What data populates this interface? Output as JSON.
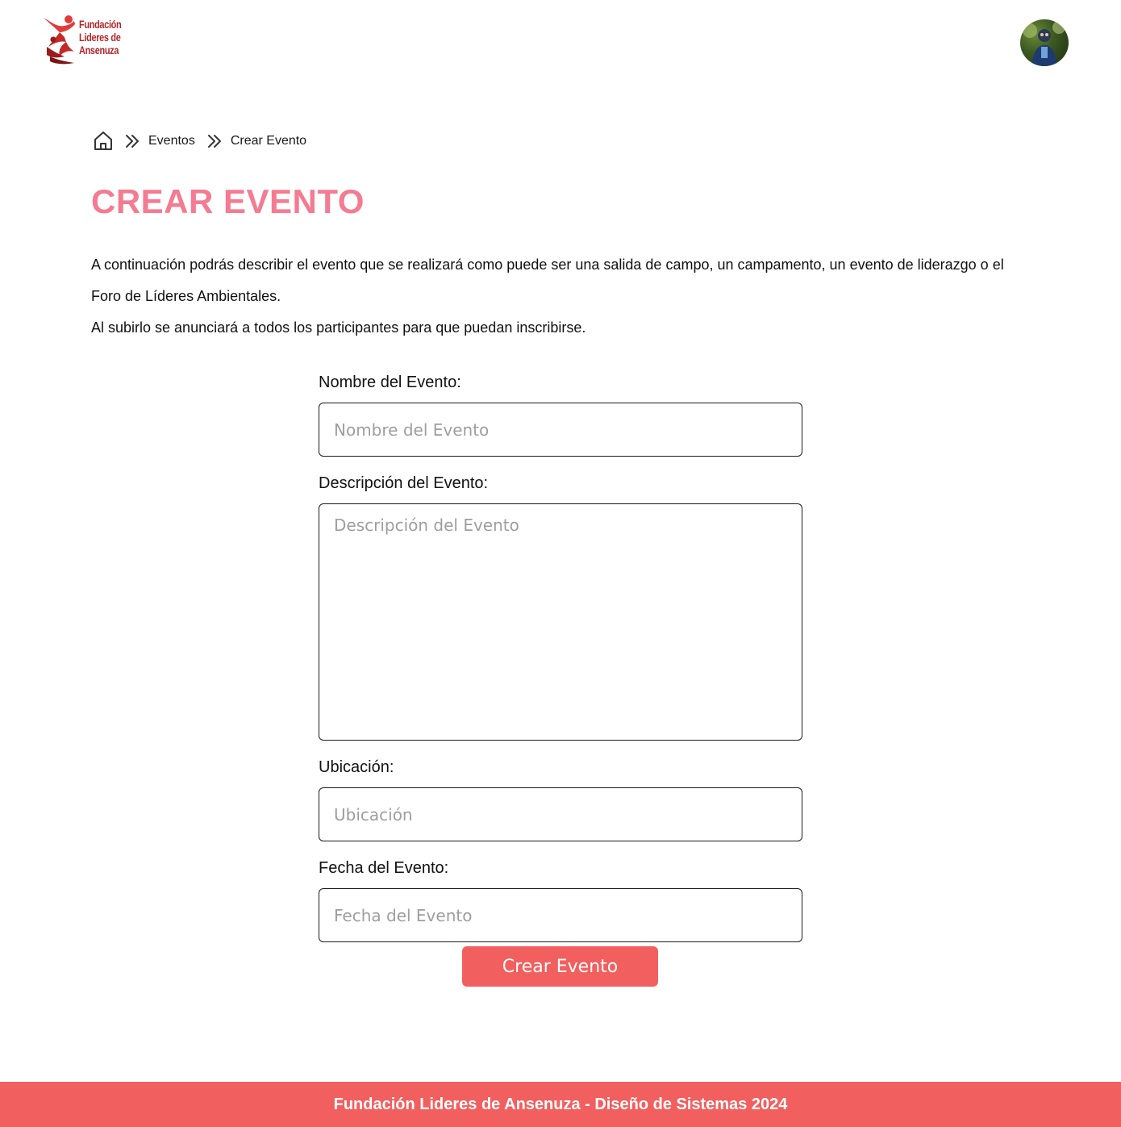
{
  "header": {
    "logo_lines": [
      "Fundación",
      "Lideres de",
      "Ansenuza"
    ],
    "brand_color": "#b3262a"
  },
  "breadcrumb": {
    "items": [
      "Eventos",
      "Crear Evento"
    ]
  },
  "page": {
    "title": "CREAR EVENTO",
    "intro_line1": "A continuación podrás describir el evento que se realizará como puede ser una salida de campo, un campamento, un evento de liderazgo o el Foro de Líderes Ambientales.",
    "intro_line2": "Al subirlo se anunciará a todos los participantes para que puedan inscribirse.",
    "title_color": "#f47b91"
  },
  "form": {
    "fields": [
      {
        "label": "Nombre del Evento:",
        "placeholder": "Nombre del Evento"
      },
      {
        "label": "Descripción del Evento:",
        "placeholder": "Descripción del Evento"
      },
      {
        "label": "Ubicación:",
        "placeholder": "Ubicación"
      },
      {
        "label": "Fecha del Evento:",
        "placeholder": "Fecha del Evento"
      }
    ],
    "submit_label": "Crear Evento",
    "accent_color": "#f25f5f"
  },
  "footer": {
    "text": "Fundación Lideres de Ansenuza - Diseño de Sistemas 2024"
  }
}
